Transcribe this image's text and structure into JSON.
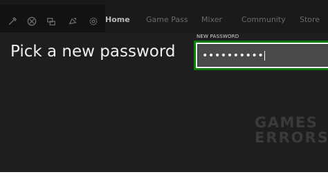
{
  "topbar": {
    "icons": [
      "achievements-icon",
      "xbox-logo-icon",
      "party-icon",
      "notifications-icon",
      "settings-icon"
    ],
    "tabs": [
      {
        "label": "Home",
        "active": true
      },
      {
        "label": "Game Pass",
        "active": false
      },
      {
        "label": "Mixer",
        "active": false
      },
      {
        "label": "Community",
        "active": false
      },
      {
        "label": "Store",
        "active": false
      }
    ]
  },
  "main": {
    "heading": "Pick a new password",
    "password_field": {
      "label": "NEW PASSWORD",
      "value": "••••••••••"
    }
  },
  "watermark": {
    "line1": "GAMES",
    "line2": "ERRORS"
  },
  "colors": {
    "background": "#1e1e1e",
    "accent": "#107c10",
    "field_fill": "#4a4a4a"
  }
}
